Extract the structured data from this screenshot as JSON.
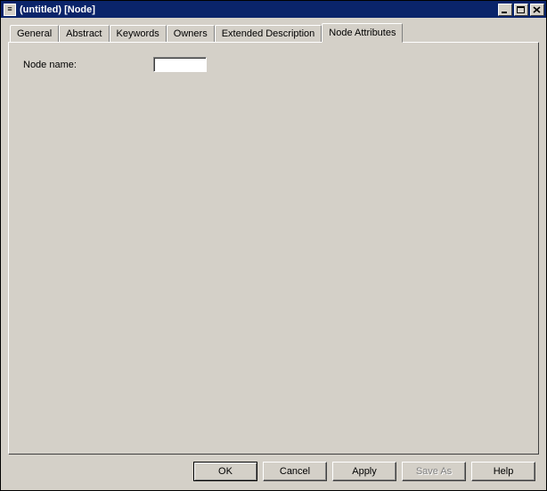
{
  "window": {
    "title": "(untitled) [Node]"
  },
  "tabs": [
    {
      "label": "General"
    },
    {
      "label": "Abstract"
    },
    {
      "label": "Keywords"
    },
    {
      "label": "Owners"
    },
    {
      "label": "Extended Description"
    },
    {
      "label": "Node Attributes",
      "active": true
    }
  ],
  "fields": {
    "node_name": {
      "label": "Node name:",
      "value": ""
    }
  },
  "buttons": {
    "ok": "OK",
    "cancel": "Cancel",
    "apply": "Apply",
    "save_as": "Save As",
    "help": "Help"
  }
}
